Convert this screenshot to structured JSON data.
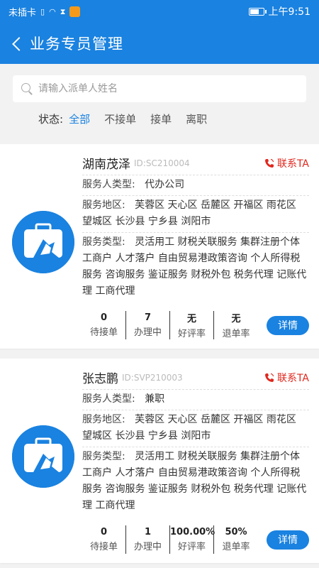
{
  "statusbar": {
    "carrier": "未插卡",
    "time": "上午9:51"
  },
  "header": {
    "title": "业务专员管理"
  },
  "search": {
    "placeholder": "请输入派单人姓名"
  },
  "filters": {
    "label": "状态:",
    "options": [
      "全部",
      "不接单",
      "接单",
      "离职"
    ],
    "active": "全部"
  },
  "colors": {
    "primary": "#1a82e0",
    "contact": "#e0281e"
  },
  "labels": {
    "type": "服务人类型:",
    "area": "服务地区:",
    "service": "服务类型:",
    "contact": "联系TA",
    "detail": "详情",
    "pending": "待接单",
    "processing": "办理中",
    "rating": "好评率",
    "refund": "退单率"
  },
  "agents": [
    {
      "name": "湖南茂泽",
      "id": "ID:SC210004",
      "type": "代办公司",
      "area": "芙蓉区 天心区 岳麓区 开福区 雨花区 望城区 长沙县 宁乡县 浏阳市",
      "services": "灵活用工 财税关联服务 集群注册个体工商户 人才落户 自由贸易港政策咨询 个人所得税服务 咨询服务 鉴证服务 财税外包 税务代理 记账代理 工商代理",
      "pending": "0",
      "processing": "7",
      "rating": "无",
      "refund": "无"
    },
    {
      "name": "张志鹏",
      "id": "ID:SVP210003",
      "type": "兼职",
      "area": "芙蓉区 天心区 岳麓区 开福区 雨花区 望城区 长沙县 宁乡县 浏阳市",
      "services": "灵活用工 财税关联服务 集群注册个体工商户 人才落户 自由贸易港政策咨询 个人所得税服务 咨询服务 鉴证服务 财税外包 税务代理 记账代理 工商代理",
      "pending": "0",
      "processing": "1",
      "rating": "100.00%",
      "refund": "50%"
    }
  ]
}
